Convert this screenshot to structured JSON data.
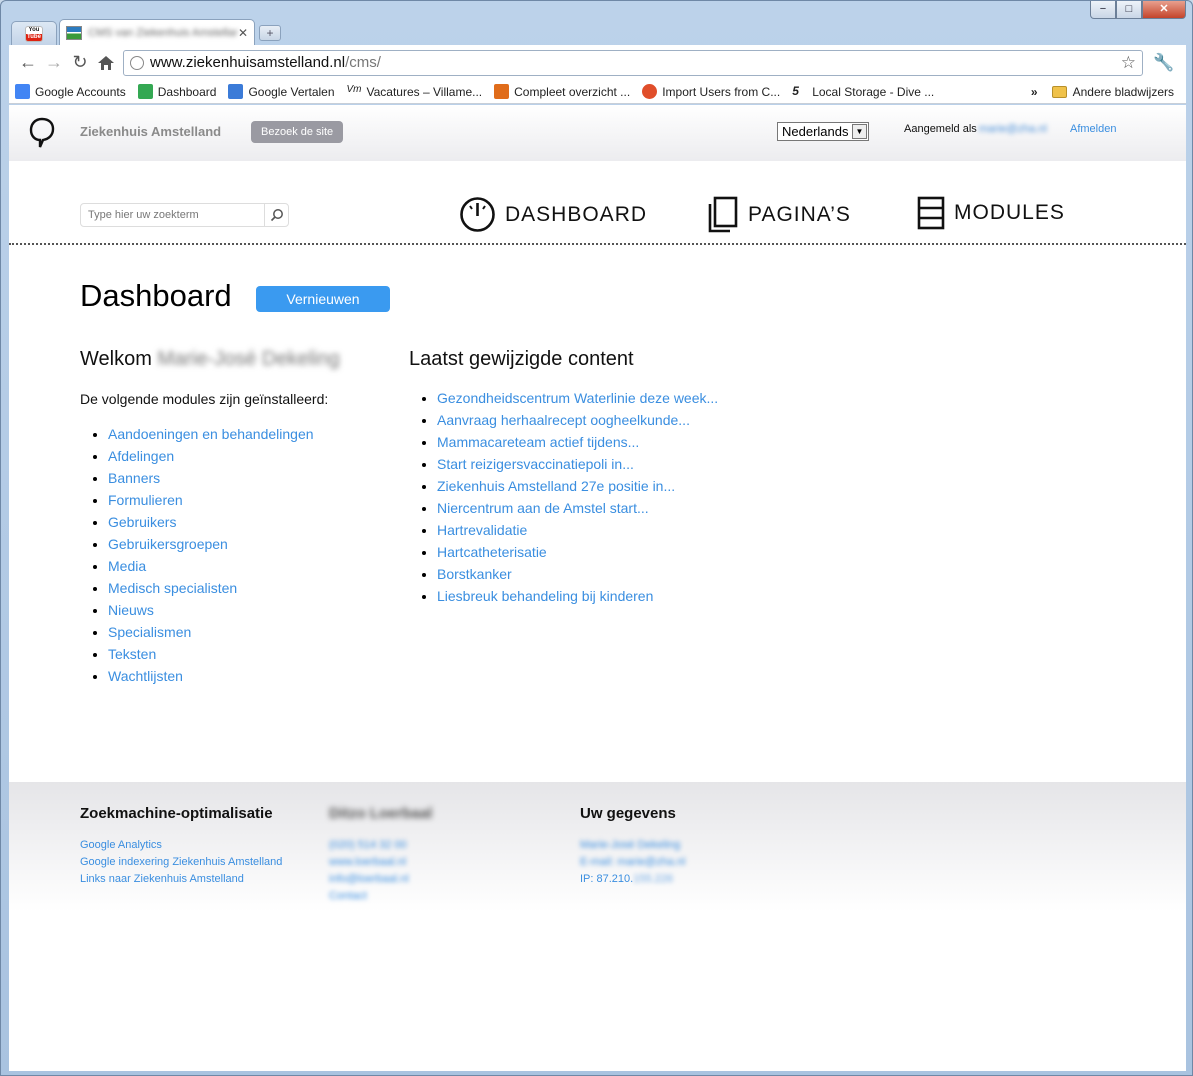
{
  "browser": {
    "window_buttons": [
      "−",
      "□",
      "✕"
    ],
    "tabs": [
      {
        "icon": "youtube-icon",
        "label_top": "You",
        "label_bottom": "Tube"
      },
      {
        "icon": "site-favicon",
        "title": "CMS van Ziekenhuis Amstelland"
      }
    ],
    "url_host": "www.ziekenhuisamstelland.nl",
    "url_path": "/cms/",
    "bookmarks": [
      {
        "label": "Google Accounts",
        "color": "#4285f4"
      },
      {
        "label": "Dashboard",
        "color": "#34a853"
      },
      {
        "label": "Google Vertalen",
        "color": "#3b7bd8"
      },
      {
        "label": "Vacatures – Villame...",
        "color": "#ffffff"
      },
      {
        "label": "Compleet overzicht ...",
        "color": "#e06c1a"
      },
      {
        "label": "Import Users from C...",
        "color": "#e04e2a"
      },
      {
        "label": "Local Storage - Dive ...",
        "color": "#ffffff"
      }
    ],
    "bookmarks_more": "»",
    "other_bookmarks": "Andere bladwijzers"
  },
  "header": {
    "brand": "Ziekenhuis Amstelland",
    "visit_site": "Bezoek de site",
    "language": "Nederlands",
    "logged_in_as": "Aangemeld als",
    "user_email": "marie@zha.nl",
    "logout": "Afmelden"
  },
  "nav": {
    "search_placeholder": "Type hier uw zoekterm",
    "items": [
      "DASHBOARD",
      "PAGINA’S",
      "MODULES"
    ]
  },
  "dashboard": {
    "title": "Dashboard",
    "refresh": "Vernieuwen",
    "welcome": "Welkom",
    "user_name": "Marie-José Dekeling",
    "installed_text": "De volgende modules zijn geïnstalleerd:",
    "modules": [
      "Aandoeningen en behandelingen",
      "Afdelingen",
      "Banners",
      "Formulieren",
      "Gebruikers",
      "Gebruikersgroepen",
      "Media",
      "Medisch specialisten",
      "Nieuws",
      "Specialismen",
      "Teksten",
      "Wachtlijsten"
    ],
    "recent_title": "Laatst gewijzigde content",
    "recent": [
      "Gezondheidscentrum Waterlinie deze week...",
      "Aanvraag herhaalrecept oogheelkunde...",
      "Mammacareteam actief tijdens...",
      "Start reizigersvaccinatiepoli in...",
      "Ziekenhuis Amstelland 27e positie in...",
      "Niercentrum aan de Amstel start...",
      "Hartrevalidatie",
      "Hartcatheterisatie",
      "Borstkanker",
      "Liesbreuk behandeling bij kinderen"
    ]
  },
  "footer": {
    "seo_title": "Zoekmachine-optimalisatie",
    "seo_links": [
      "Google Analytics",
      "Google indexering Ziekenhuis Amstelland",
      "Links naar Ziekenhuis Amstelland"
    ],
    "agency_title": "Ditzo Loerbaal",
    "agency_lines": [
      "(020) 514 32 00",
      "www.loerbaal.nl",
      "info@loerbaal.nl",
      "Contact"
    ],
    "user_title": "Uw gegevens",
    "user_name": "Marie-José Dekeling",
    "user_email": "E-mail: marie@zha.nl",
    "ip_prefix": "IP: 87.210.",
    "ip_suffix": "155.226"
  }
}
